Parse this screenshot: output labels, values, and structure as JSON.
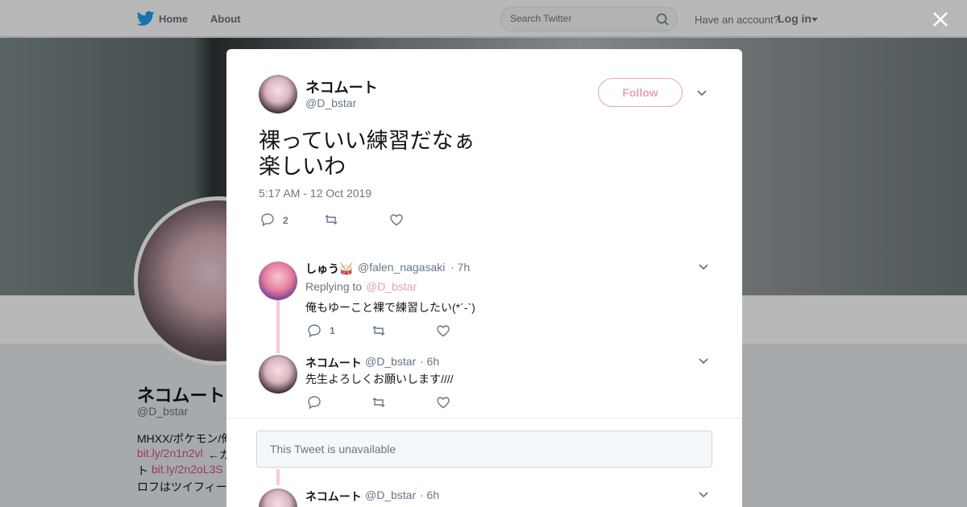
{
  "topnav": {
    "home_label": "Home",
    "about_label": "About",
    "search_placeholder": "Search Twitter",
    "have_account": "Have an account?",
    "login_label": "Log in"
  },
  "profile": {
    "name": "ネコムート",
    "handle": "@D_bstar",
    "bio_line1": "MHXX/ポケモン/俺",
    "bio_link1": "bit.ly/2n1n2vl",
    "bio_line2": " ←カ",
    "bio_line3_prefix": "ト",
    "bio_link2": "bit.ly/2n2oL3S",
    "bio_line4": "ロフはツイフィー"
  },
  "tweet": {
    "author_name": "ネコムート",
    "author_handle": "@D_bstar",
    "follow_label": "Follow",
    "text_line1": "裸っていい練習だなぁ",
    "text_line2": "楽しいわ",
    "timestamp": "5:17 AM - 12 Oct 2019",
    "reply_count": "2"
  },
  "replies": [
    {
      "name": "しゅう🥁",
      "handle": "@falen_nagasaki",
      "time": "· 7h",
      "replying_to_label": "Replying to",
      "replying_to_handle": "@D_bstar",
      "text": "俺もゆーこと裸で練習したい(*´-`)",
      "reply_count": "1"
    },
    {
      "name": "ネコムート",
      "handle": "@D_bstar",
      "time": "· 6h",
      "text": "先生よろしくお願いします////"
    },
    {
      "name": "ネコムート",
      "handle": "@D_bstar",
      "time": "· 6h"
    }
  ],
  "unavailable_text": "This Tweet is unavailable",
  "colors": {
    "accent_pink": "#e8a1b4",
    "twitter_blue": "#1da1f2",
    "muted_gray": "#657786",
    "thread_line": "#f5c9d6"
  },
  "icons": {
    "bird": "twitter-bird-icon",
    "search": "search-icon",
    "close": "close-icon",
    "reply": "reply-icon",
    "retweet": "retweet-icon",
    "like": "heart-icon",
    "caret": "chevron-down-icon"
  }
}
